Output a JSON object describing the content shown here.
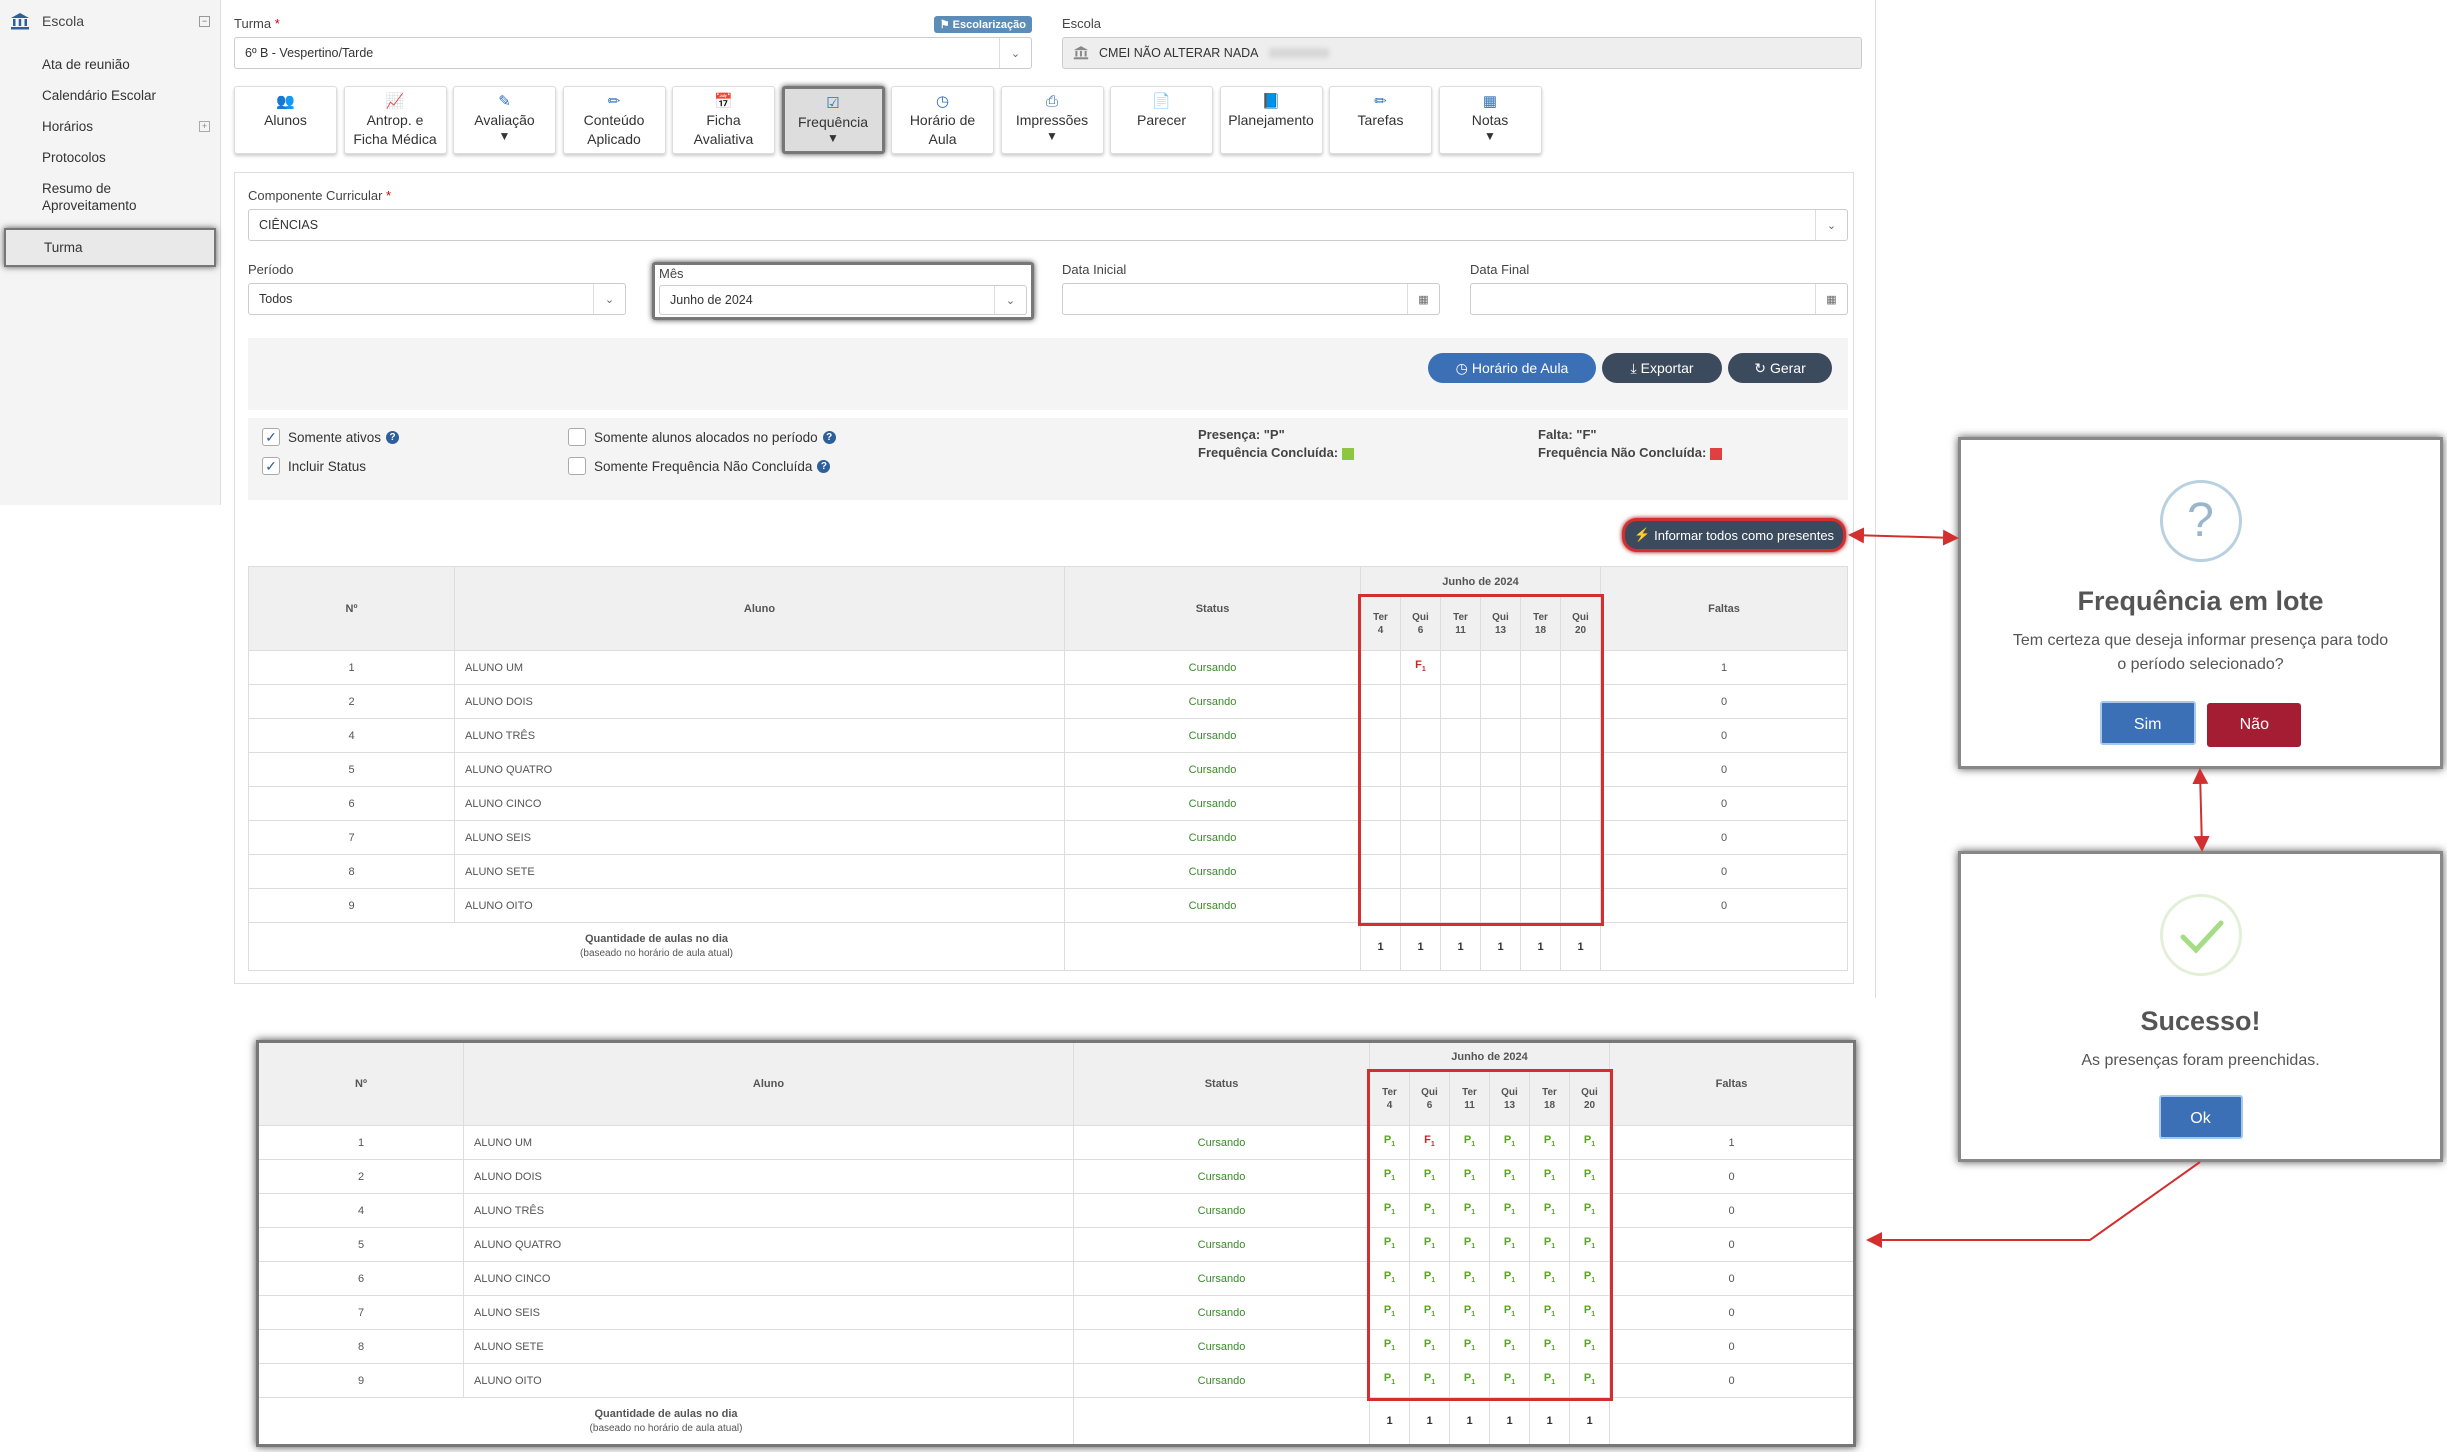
{
  "sidebar": {
    "section": "Escola",
    "items": [
      "Ata de reunião",
      "Calendário Escolar",
      "Horários",
      "Protocolos",
      "Resumo de\nAproveitamento",
      "Turma"
    ]
  },
  "turma": {
    "label": "Turma",
    "value": "6º B - Vespertino/Tarde",
    "badge": "Escolarização"
  },
  "escola": {
    "label": "Escola",
    "value": "CMEI NÃO ALTERAR NADA"
  },
  "tabs": [
    {
      "label": "Alunos",
      "icon": "users-icon"
    },
    {
      "label": "Antrop. e\nFicha Médica",
      "icon": "chart-icon"
    },
    {
      "label": "Avaliação",
      "icon": "edit-icon",
      "caret": true
    },
    {
      "label": "Conteúdo\nAplicado",
      "icon": "pencil-icon"
    },
    {
      "label": "Ficha\nAvaliativa",
      "icon": "calendar-icon"
    },
    {
      "label": "Frequência",
      "icon": "check-square-icon",
      "caret": true,
      "active": true
    },
    {
      "label": "Horário de\nAula",
      "icon": "clock-icon"
    },
    {
      "label": "Impressões",
      "icon": "print-icon",
      "caret": true
    },
    {
      "label": "Parecer",
      "icon": "file-icon"
    },
    {
      "label": "Planejamento",
      "icon": "book-icon"
    },
    {
      "label": "Tarefas",
      "icon": "pencil-icon"
    },
    {
      "label": "Notas",
      "icon": "table-icon",
      "caret": true
    }
  ],
  "form": {
    "componente": {
      "label": "Componente Curricular",
      "value": "CIÊNCIAS"
    },
    "periodo": {
      "label": "Período",
      "value": "Todos"
    },
    "mes": {
      "label": "Mês",
      "value": "Junho de 2024"
    },
    "data_inicial": {
      "label": "Data Inicial",
      "value": ""
    },
    "data_final": {
      "label": "Data Final",
      "value": ""
    },
    "buttons": {
      "horario": "Horário de Aula",
      "exportar": "Exportar",
      "gerar": "Gerar"
    },
    "checks": {
      "somente_ativos": "Somente ativos",
      "incluir_status": "Incluir Status",
      "somente_alocados": "Somente alunos alocados no período",
      "somente_nao_concluida": "Somente Frequência Não Concluída"
    },
    "legend": {
      "presenca": "Presença: \"P\"",
      "concluida": "Frequência Concluída:",
      "falta": "Falta: \"F\"",
      "nao_concluida": "Frequência Não Concluída:",
      "green": "#8dc63f",
      "red": "#e04040"
    },
    "informar_btn": "Informar todos como presentes"
  },
  "table": {
    "headers": {
      "num": "Nº",
      "aluno": "Aluno",
      "status": "Status",
      "month": "Junho de 2024",
      "faltas": "Faltas"
    },
    "days": [
      [
        "Ter",
        "4"
      ],
      [
        "Qui",
        "6"
      ],
      [
        "Ter",
        "11"
      ],
      [
        "Qui",
        "13"
      ],
      [
        "Ter",
        "18"
      ],
      [
        "Qui",
        "20"
      ]
    ],
    "rows": [
      {
        "n": "1",
        "name": "ALUNO UM",
        "status": "Cursando",
        "faltas": "1"
      },
      {
        "n": "2",
        "name": "ALUNO DOIS",
        "status": "Cursando",
        "faltas": "0"
      },
      {
        "n": "4",
        "name": "ALUNO TRÊS",
        "status": "Cursando",
        "faltas": "0"
      },
      {
        "n": "5",
        "name": "ALUNO QUATRO",
        "status": "Cursando",
        "faltas": "0"
      },
      {
        "n": "6",
        "name": "ALUNO CINCO",
        "status": "Cursando",
        "faltas": "0"
      },
      {
        "n": "7",
        "name": "ALUNO SEIS",
        "status": "Cursando",
        "faltas": "0"
      },
      {
        "n": "8",
        "name": "ALUNO SETE",
        "status": "Cursando",
        "faltas": "0"
      },
      {
        "n": "9",
        "name": "ALUNO OITO",
        "status": "Cursando",
        "faltas": "0"
      }
    ],
    "footer_title": "Quantidade de aulas no dia",
    "footer_sub": "(baseado no horário de aula atual)",
    "footer_counts": [
      "1",
      "1",
      "1",
      "1",
      "1",
      "1"
    ],
    "p_mark": "P",
    "f_mark": "F",
    "mark_sub": "1"
  },
  "modal_confirm": {
    "icon": "?",
    "title": "Frequência em lote",
    "text": "Tem certeza que deseja informar presença para todo o período selecionado?",
    "yes": "Sim",
    "no": "Não"
  },
  "modal_success": {
    "title": "Sucesso!",
    "text": "As presenças foram preenchidas.",
    "ok": "Ok"
  }
}
